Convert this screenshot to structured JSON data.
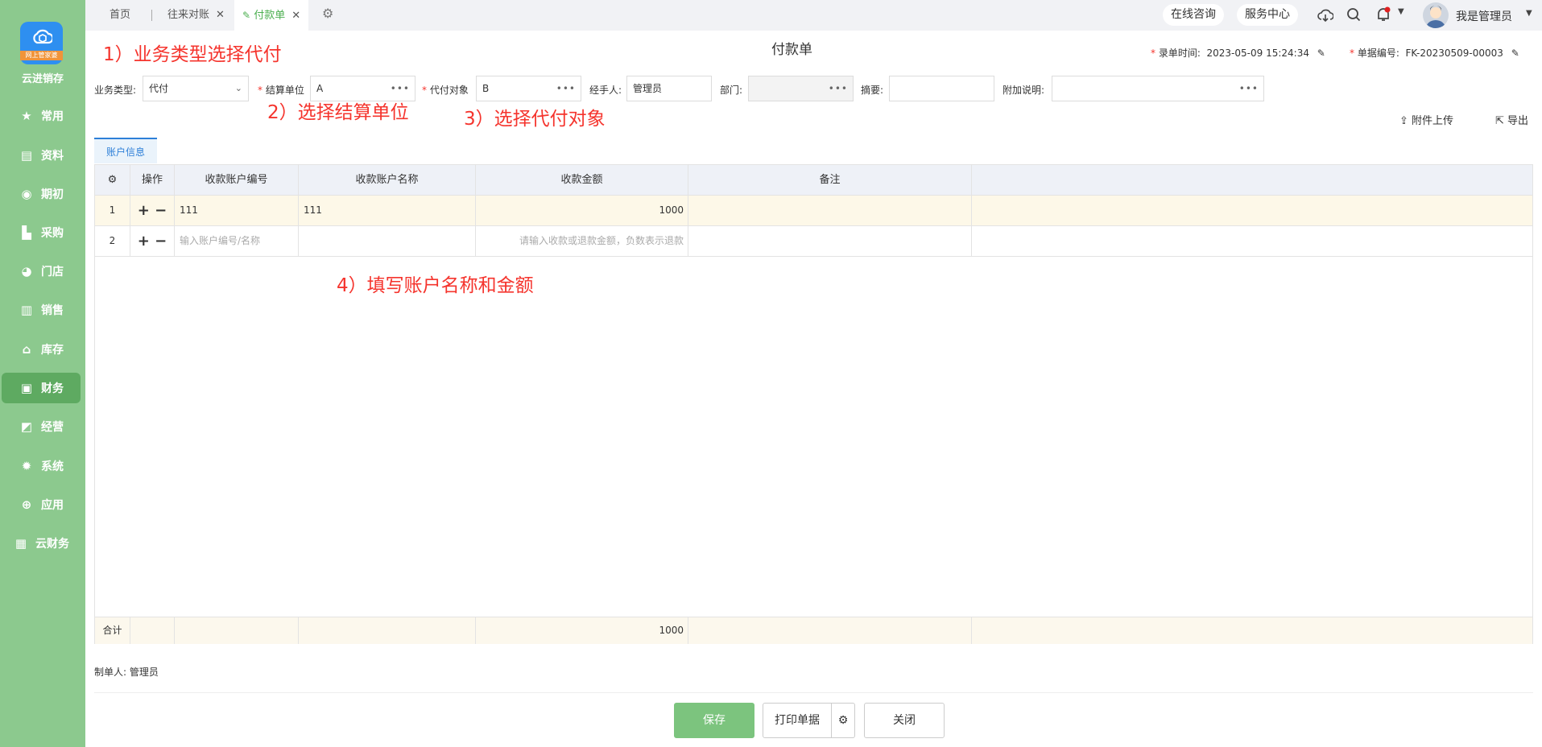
{
  "sidebar": {
    "brand": "云进销存",
    "logo_ribbon": "网上管家婆",
    "items": [
      {
        "label": "常用",
        "icon": "star-icon"
      },
      {
        "label": "资料",
        "icon": "document-icon"
      },
      {
        "label": "期初",
        "icon": "target-icon"
      },
      {
        "label": "采购",
        "icon": "cart-icon"
      },
      {
        "label": "门店",
        "icon": "pie-icon"
      },
      {
        "label": "销售",
        "icon": "chart-icon"
      },
      {
        "label": "库存",
        "icon": "house-icon"
      },
      {
        "label": "财务",
        "icon": "wallet-icon"
      },
      {
        "label": "经营",
        "icon": "trend-icon"
      },
      {
        "label": "系统",
        "icon": "gear-icon"
      },
      {
        "label": "应用",
        "icon": "plus-icon"
      },
      {
        "label": "云财务",
        "icon": "cloud-finance-icon"
      }
    ]
  },
  "tabs": {
    "home": "首页",
    "reconcile": "往来对账",
    "payment": "付款单"
  },
  "header": {
    "consult": "在线咨询",
    "service": "服务中心",
    "user": "我是管理员"
  },
  "annotations": {
    "a1": "1）业务类型选择代付",
    "a2": "2）选择结算单位",
    "a3": "3）选择代付对象",
    "a4": "4）填写账户名称和金额"
  },
  "doc": {
    "title": "付款单",
    "time_label": "录单时间:",
    "time_value": "2023-05-09 15:24:34",
    "no_label": "单据编号:",
    "no_value": "FK-20230509-00003"
  },
  "form": {
    "biz_type_label": "业务类型:",
    "biz_type_value": "代付",
    "settle_label": "结算单位",
    "settle_value": "A",
    "agent_label": "代付对象",
    "agent_value": "B",
    "handler_label": "经手人:",
    "handler_value": "管理员",
    "dept_label": "部门:",
    "dept_value": "",
    "summary_label": "摘要:",
    "summary_value": "",
    "note_label": "附加说明:",
    "note_value": ""
  },
  "toolbar": {
    "upload": "附件上传",
    "export": "导出"
  },
  "section_tab": "账户信息",
  "table": {
    "headers": [
      "操作",
      "收款账户编号",
      "收款账户名称",
      "收款金额",
      "备注"
    ],
    "rows": [
      {
        "no": "1",
        "code": "111",
        "name": "111",
        "amount": "1000",
        "remark": ""
      },
      {
        "no": "2",
        "code": "",
        "name": "",
        "amount": "",
        "remark": ""
      }
    ],
    "placeholders": {
      "code": "输入账户编号/名称",
      "amount": "请输入收款或退款金额，负数表示退款"
    },
    "total_label": "合计",
    "total_amount": "1000"
  },
  "maker": {
    "label": "制单人:",
    "value": "管理员"
  },
  "buttons": {
    "save": "保存",
    "print": "打印单据",
    "close": "关闭"
  },
  "colors": {
    "sidebar": "#8cc98e",
    "sidebar_active": "#5eaa61",
    "accent": "#4caf50",
    "annotation": "#f5342d",
    "link": "#2d7fd8"
  }
}
